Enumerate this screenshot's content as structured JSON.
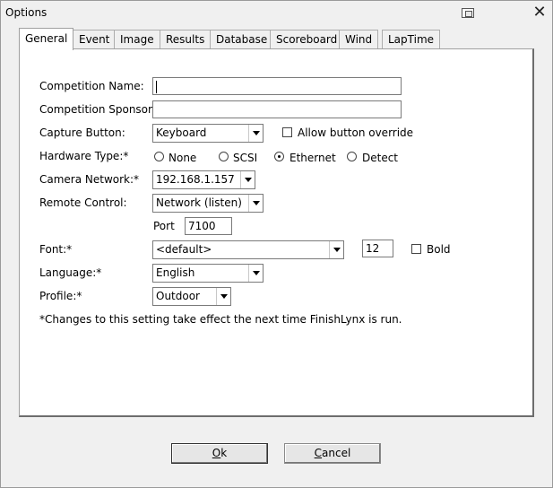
{
  "window": {
    "title": "Options"
  },
  "tabs": [
    "General",
    "Event",
    "Image",
    "Results",
    "Database",
    "Scoreboard",
    "Wind",
    "LapTime"
  ],
  "form": {
    "competition_name_label": "Competition Name:",
    "competition_name_value": "",
    "competition_sponsor_label": "Competition Sponsor:",
    "competition_sponsor_value": "",
    "capture_button_label": "Capture Button:",
    "capture_button_value": "Keyboard",
    "allow_override_label": "Allow button override",
    "allow_override_checked": false,
    "hardware_type_label": "Hardware Type:*",
    "hardware_options": [
      "None",
      "SCSI",
      "Ethernet",
      "Detect"
    ],
    "hardware_selected": "Ethernet",
    "camera_network_label": "Camera Network:*",
    "camera_network_value": "192.168.1.157",
    "remote_control_label": "Remote Control:",
    "remote_control_value": "Network (listen)",
    "port_label": "Port",
    "port_value": "7100",
    "font_label": "Font:*",
    "font_value": "<default>",
    "font_size_value": "12",
    "bold_label": "Bold",
    "bold_checked": false,
    "language_label": "Language:*",
    "language_value": "English",
    "profile_label": "Profile:*",
    "profile_value": "Outdoor",
    "note": "*Changes to this setting take effect the next time FinishLynx is run."
  },
  "buttons": {
    "ok_prefix": "O",
    "ok_rest": "k",
    "cancel_prefix": "C",
    "cancel_rest": "ancel"
  }
}
